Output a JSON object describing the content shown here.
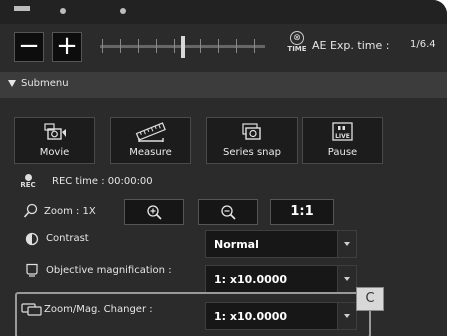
{
  "top": {
    "zoom_out_symbol": "−",
    "zoom_in_symbol": "+",
    "slider_position": 0.5,
    "time_icon_text": "TIME",
    "ae_label": "AE Exp. time :",
    "ae_value": "1/6.4"
  },
  "submenu": {
    "label": "Submenu"
  },
  "tools": {
    "movie": "Movie",
    "measure": "Measure",
    "series_snap": "Series snap",
    "pause": "Pause",
    "live_badge": "LIVE"
  },
  "rec": {
    "icon_text": "REC",
    "time": "REC time : 00:00:00"
  },
  "zoom": {
    "label": "Zoom : 1X",
    "one_to_one": "1:1"
  },
  "contrast": {
    "label": "Contrast",
    "value": "Normal"
  },
  "objective": {
    "label": "Objective magnification :",
    "value": "1: x10.0000"
  },
  "changer": {
    "label": "Zoom/Mag. Changer :",
    "value": "1: x10.0000"
  },
  "callout": {
    "label": "C"
  }
}
